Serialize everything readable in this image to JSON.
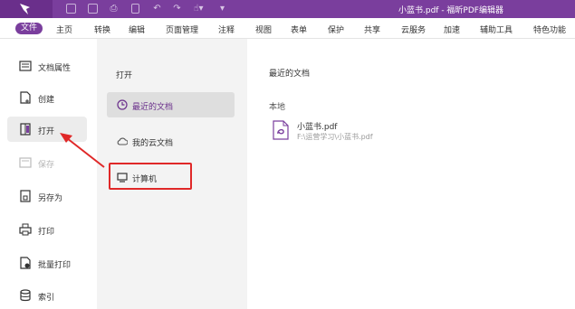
{
  "window": {
    "title": "小蓝书.pdf - 福昕PDF编辑器",
    "accent_color": "#7a3e9d"
  },
  "quick_access": [
    "open-folder-icon",
    "save-icon",
    "print-icon",
    "new-document-icon",
    "undo-icon",
    "redo-icon",
    "hand-icon",
    "customize-dropdown-icon"
  ],
  "menu": {
    "file": "文件",
    "items": [
      "主页",
      "转换",
      "编辑",
      "页面管理",
      "注释",
      "视图",
      "表单",
      "保护",
      "共享",
      "云服务",
      "加速",
      "辅助工具",
      "特色功能"
    ]
  },
  "sidebar": {
    "items": [
      {
        "label": "文档属性",
        "icon": "properties-icon"
      },
      {
        "label": "创建",
        "icon": "create-icon"
      },
      {
        "label": "打开",
        "icon": "open-book-icon"
      },
      {
        "label": "保存",
        "icon": "save-icon"
      },
      {
        "label": "另存为",
        "icon": "save-as-icon"
      },
      {
        "label": "打印",
        "icon": "print-icon"
      },
      {
        "label": "批量打印",
        "icon": "batch-print-icon"
      },
      {
        "label": "索引",
        "icon": "index-icon"
      }
    ]
  },
  "open_panel": {
    "title": "打开",
    "items": [
      {
        "label": "最近的文档",
        "icon": "clock-icon"
      },
      {
        "label": "我的云文档",
        "icon": "cloud-icon"
      },
      {
        "label": "计算机",
        "icon": "computer-icon"
      }
    ]
  },
  "recent": {
    "title": "最近的文档",
    "group_label": "本地",
    "files": [
      {
        "name": "小蓝书.pdf",
        "path": "F:\\运营学习\\小蓝书.pdf",
        "icon": "pdf-file-icon"
      }
    ]
  },
  "annotation": {
    "box_color": "#e02828"
  }
}
